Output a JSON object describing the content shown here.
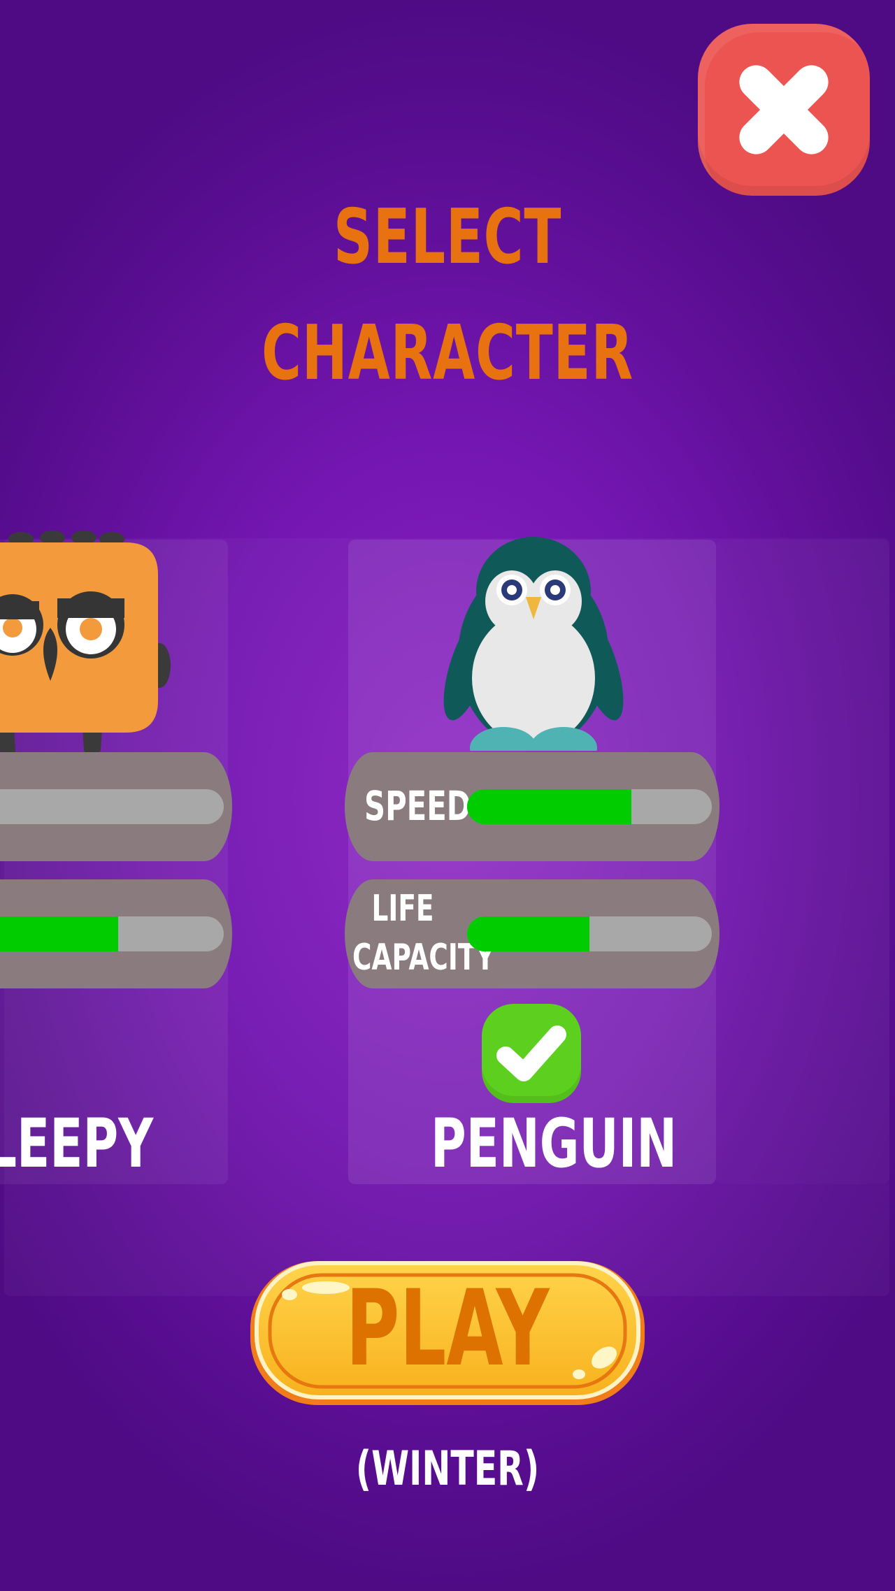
{
  "header": {
    "title_line1": "SELECT",
    "title_line2": "CHARACTER"
  },
  "colors": {
    "background": "#7416b2",
    "title": "#e8720f",
    "close_button": "#ec5451",
    "stat_panel": "#8a7c7e",
    "bar_fill": "#00cc00",
    "bar_track": "#a8a8a8",
    "check_button": "#5ccf1f",
    "play_button": "#fbbd2c",
    "play_text": "#dd7200"
  },
  "characters": [
    {
      "name": "LEEPY",
      "icon": "owl-character-icon",
      "stats": [
        {
          "label": "",
          "level": 0.08
        },
        {
          "label": "",
          "level": 0.58
        }
      ]
    },
    {
      "name": "PENGUIN",
      "icon": "penguin-character-icon",
      "selected": true,
      "stats": [
        {
          "label": "SPEED",
          "level": 0.67
        },
        {
          "label_line1": "LIFE",
          "label_line2": "CAPACITY",
          "level": 0.5
        }
      ]
    }
  ],
  "icons": {
    "close": "close-icon",
    "selected": "check-icon"
  },
  "play": {
    "label": "PLAY"
  },
  "map": {
    "label": "(WINTER)"
  }
}
